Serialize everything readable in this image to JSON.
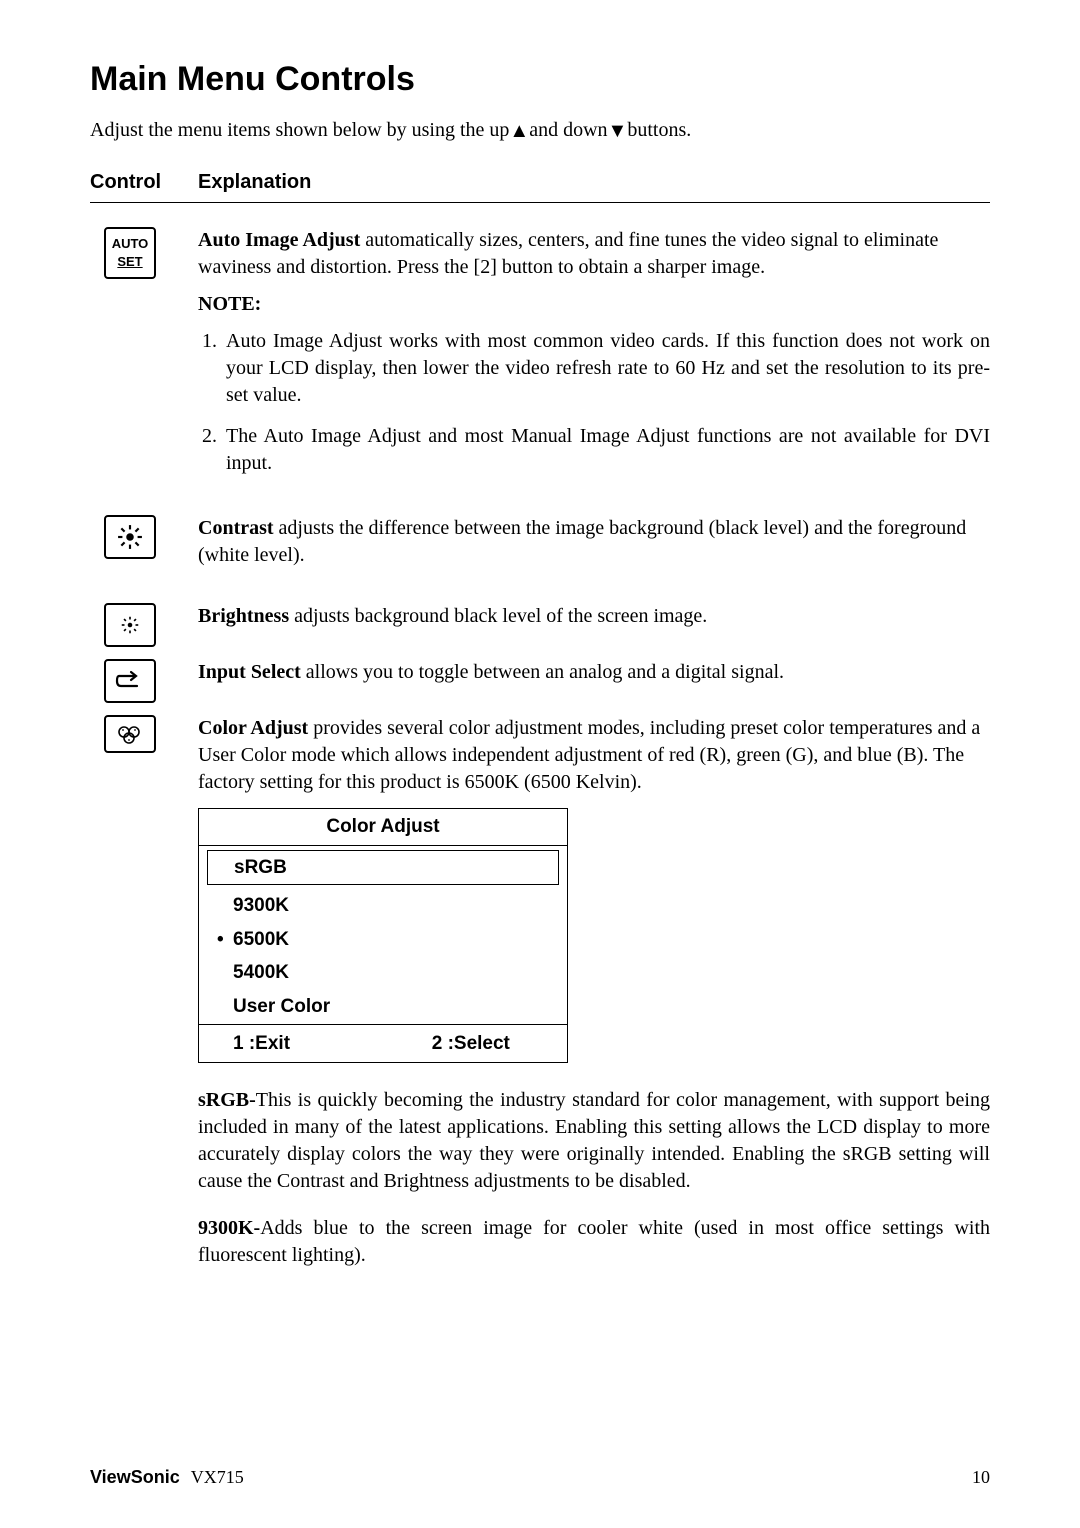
{
  "title": "Main Menu Controls",
  "intro_pre": "Adjust the menu items shown below by using the up",
  "intro_mid": "and down",
  "intro_post": "buttons.",
  "headers": {
    "control": "Control",
    "explanation": "Explanation"
  },
  "auto_icon": {
    "line1": "AUTO",
    "line2": "SET"
  },
  "auto": {
    "lead_bold": "Auto Image Adjust",
    "lead_rest": " automatically sizes, centers, and fine tunes the video signal to eliminate waviness and distortion. Press the [2] button to obtain a sharper image.",
    "note_label": "NOTE:",
    "note1": "Auto Image Adjust works with most common video cards. If this function does not work on your LCD display, then lower the video refresh rate to 60 Hz and set the resolution to its pre-set value.",
    "note2": "The Auto Image Adjust and most Manual Image Adjust functions are not available for DVI input."
  },
  "contrast": {
    "lead_bold": "Contrast",
    "lead_rest": " adjusts the difference between the image background  (black level) and the foreground (white level)."
  },
  "brightness": {
    "lead_bold": "Brightness",
    "lead_rest": " adjusts background black level of the screen image."
  },
  "input": {
    "lead_bold": "Input Select",
    "lead_rest": " allows you to toggle between an analog and a digital signal."
  },
  "color": {
    "lead_bold": "Color Adjust",
    "lead_rest": " provides several color adjustment modes, including preset color temperatures and a User Color mode which allows independent adjustment of red (R), green (G), and blue (B). The factory setting for this product is 6500K (6500 Kelvin)."
  },
  "color_box": {
    "title": "Color Adjust",
    "rows": [
      "sRGB",
      "9300K",
      "6500K",
      "5400K",
      "User Color"
    ],
    "footer_left": "1 :Exit",
    "footer_right": "2 :Select"
  },
  "srgb": {
    "lead_bold": "sRGB-",
    "lead_rest": "This is quickly becoming the industry standard for color management, with support being included in many of the latest applications. Enabling this setting allows the LCD display to more accurately display colors the way they were originally intended. Enabling the sRGB setting will cause the Contrast and Brightness adjustments to be disabled."
  },
  "k9300": {
    "lead_bold": "9300K-",
    "lead_rest": "Adds blue to the screen image for cooler white (used in most office settings with fluorescent lighting)."
  },
  "footer": {
    "brand": "ViewSonic",
    "model": "VX715",
    "page": "10"
  }
}
